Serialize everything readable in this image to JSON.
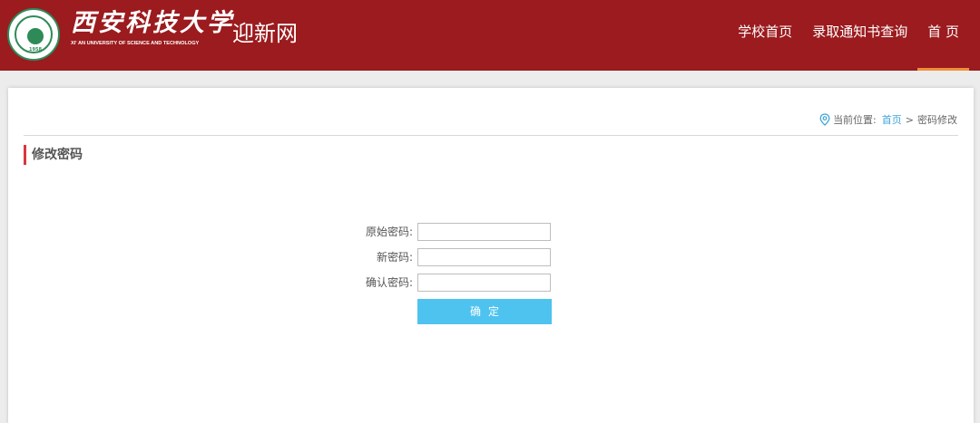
{
  "header": {
    "logo_cn": "西安科技大学",
    "logo_en": "XI' AN UNIVERSITY OF SCIENCE AND TECHNOLOGY",
    "seal_year": "1958",
    "site_name": "迎新网",
    "nav": [
      {
        "label": "学校首页",
        "active": false
      },
      {
        "label": "录取通知书查询",
        "active": false
      },
      {
        "label": "首 页",
        "active": true
      }
    ],
    "colors": {
      "bg": "#9b1b1e",
      "active_underline": "#ef8f3a"
    }
  },
  "breadcrumb": {
    "prefix": "当前位置:",
    "home": "首页",
    "separator": ">",
    "current": "密码修改"
  },
  "section": {
    "title": "修改密码"
  },
  "form": {
    "fields": [
      {
        "label": "原始密码:",
        "value": ""
      },
      {
        "label": "新密码:",
        "value": ""
      },
      {
        "label": "确认密码:",
        "value": ""
      }
    ],
    "submit_label": "确定",
    "submit_color": "#4fc3ef"
  }
}
